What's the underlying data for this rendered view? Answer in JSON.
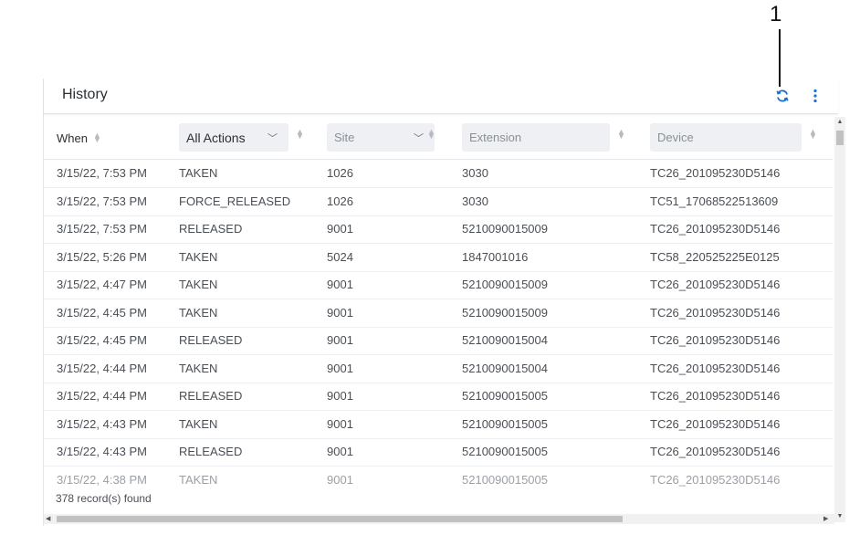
{
  "annotation": {
    "number": "1"
  },
  "panel": {
    "title": "History",
    "refresh_icon": "refresh-icon",
    "more_icon": "more-vertical-icon"
  },
  "columns": {
    "when": "When",
    "actions_filter": "All Actions",
    "site_placeholder": "Site",
    "extension_placeholder": "Extension",
    "device_placeholder": "Device"
  },
  "rows": [
    {
      "when": "3/15/22, 7:53 PM",
      "action": "TAKEN",
      "site": "1026",
      "extension": "3030",
      "device": "TC26_201095230D5146"
    },
    {
      "when": "3/15/22, 7:53 PM",
      "action": "FORCE_RELEASED",
      "site": "1026",
      "extension": "3030",
      "device": "TC51_17068522513609"
    },
    {
      "when": "3/15/22, 7:53 PM",
      "action": "RELEASED",
      "site": "9001",
      "extension": "5210090015009",
      "device": "TC26_201095230D5146"
    },
    {
      "when": "3/15/22, 5:26 PM",
      "action": "TAKEN",
      "site": "5024",
      "extension": "1847001016",
      "device": "TC58_220525225E0125"
    },
    {
      "when": "3/15/22, 4:47 PM",
      "action": "TAKEN",
      "site": "9001",
      "extension": "5210090015009",
      "device": "TC26_201095230D5146"
    },
    {
      "when": "3/15/22, 4:45 PM",
      "action": "TAKEN",
      "site": "9001",
      "extension": "5210090015009",
      "device": "TC26_201095230D5146"
    },
    {
      "when": "3/15/22, 4:45 PM",
      "action": "RELEASED",
      "site": "9001",
      "extension": "5210090015004",
      "device": "TC26_201095230D5146"
    },
    {
      "when": "3/15/22, 4:44 PM",
      "action": "TAKEN",
      "site": "9001",
      "extension": "5210090015004",
      "device": "TC26_201095230D5146"
    },
    {
      "when": "3/15/22, 4:44 PM",
      "action": "RELEASED",
      "site": "9001",
      "extension": "5210090015005",
      "device": "TC26_201095230D5146"
    },
    {
      "when": "3/15/22, 4:43 PM",
      "action": "TAKEN",
      "site": "9001",
      "extension": "5210090015005",
      "device": "TC26_201095230D5146"
    },
    {
      "when": "3/15/22, 4:43 PM",
      "action": "RELEASED",
      "site": "9001",
      "extension": "5210090015005",
      "device": "TC26_201095230D5146"
    },
    {
      "when": "3/15/22, 4:38 PM",
      "action": "TAKEN",
      "site": "9001",
      "extension": "5210090015005",
      "device": "TC26_201095230D5146"
    }
  ],
  "footer": {
    "records_found": "378 record(s) found"
  },
  "colors": {
    "accent": "#1f6fd1",
    "header_bg": "#ffffff",
    "filter_bg": "#eef0f3"
  }
}
